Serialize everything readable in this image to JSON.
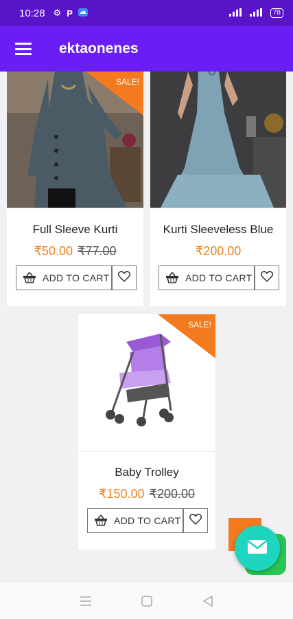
{
  "status_bar": {
    "time": "10:28",
    "battery": "78"
  },
  "app_bar": {
    "title": "ektaonenes"
  },
  "products": [
    {
      "name": "Full Sleeve Kurti",
      "price": "₹50.00",
      "old_price": "₹77.00",
      "sale": "SALE!",
      "add_to_cart": "ADD TO CART"
    },
    {
      "name": "Kurti Sleeveless Blue",
      "price": "₹200.00",
      "old_price": "",
      "sale": "",
      "add_to_cart": "ADD TO CART"
    },
    {
      "name": "Baby Trolley",
      "price": "₹150.00",
      "old_price": "₹200.00",
      "sale": "SALE!",
      "add_to_cart": "ADD TO CART"
    }
  ],
  "colors": {
    "status_bar": "#5a14c8",
    "app_bar": "#6a1ef4",
    "sale": "#f47a1f",
    "price": "#f08020",
    "chat_fab": "#1ed6c0"
  },
  "icons": [
    "menu-icon",
    "cart-basket-icon",
    "heart-icon",
    "mail-icon",
    "nav-menu-icon",
    "nav-home-icon",
    "nav-back-icon"
  ]
}
